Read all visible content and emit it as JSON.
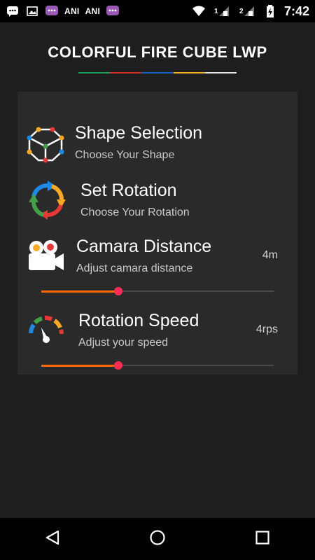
{
  "status_bar": {
    "notification_labels": [
      "ANI",
      "ANI"
    ],
    "sim1_label": "1",
    "sim2_label": "2",
    "time": "7:42"
  },
  "app": {
    "title": "COLORFUL FIRE CUBE LWP",
    "underline_colors": [
      "#1aa260",
      "#d32f2f",
      "#1565c0",
      "#f9a825",
      "#e0e0e0"
    ]
  },
  "settings": [
    {
      "title": "Shape Selection",
      "subtitle": "Choose Your Shape",
      "icon": "cube-icon"
    },
    {
      "title": "Set Rotation",
      "subtitle": "Choose Your Rotation",
      "icon": "rotation-arrows-icon"
    },
    {
      "title": "Camara Distance",
      "subtitle": "Adjust camara distance",
      "value": "4m",
      "slider_fraction": 0.33,
      "icon": "video-camera-icon"
    },
    {
      "title": "Rotation Speed",
      "subtitle": "Adjust your speed",
      "value": "4rps",
      "slider_fraction": 0.33,
      "icon": "speedometer-icon"
    }
  ],
  "colors": {
    "slider_fill": "#ff6a00",
    "slider_thumb": "#ff2d55",
    "card_bg": "#2a2a2a",
    "page_bg": "#1e1e1e"
  },
  "nav_bar": {
    "buttons": [
      "back-icon",
      "home-icon",
      "recents-icon"
    ]
  }
}
